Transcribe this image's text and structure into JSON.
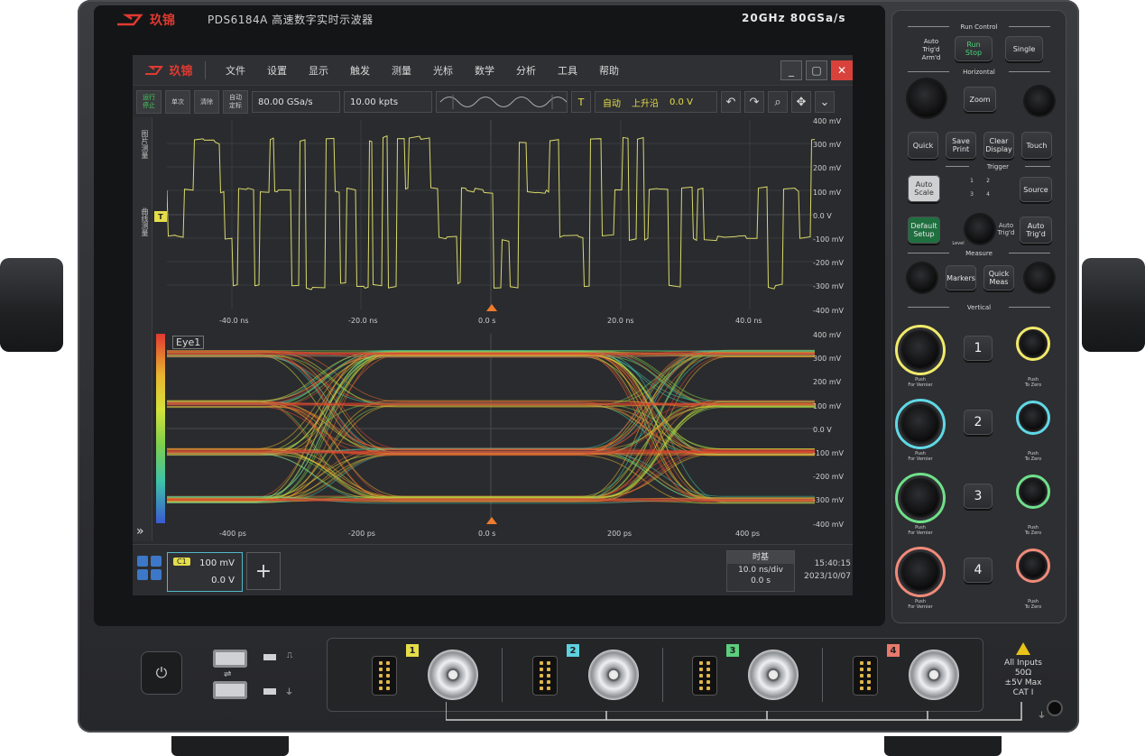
{
  "device": {
    "brand": "玖锦",
    "model_title": "PDS6184A 高速数字实时示波器",
    "spec": "20GHz 80GSa/s"
  },
  "screen": {
    "brand": "玖锦",
    "menu": [
      "文件",
      "设置",
      "显示",
      "触发",
      "测量",
      "光标",
      "数学",
      "分析",
      "工具",
      "帮助"
    ],
    "window_buttons": {
      "minimize": "_",
      "maximize": "▢",
      "close": "✕"
    },
    "toolbar": {
      "run_stop": "运行\n停止",
      "single": "单次",
      "clear": "清除",
      "auto_scale": "自动\n定标",
      "sample_rate": "80.00 GSa/s",
      "memory_depth": "10.00 kpts",
      "trigger_tag": "T",
      "trigger_mode": "自动",
      "trigger_edge": "上升沿",
      "trigger_level": "0.0 V"
    },
    "sidebar_tabs": [
      "图片测量",
      "曲线测量"
    ],
    "waveform": {
      "y_labels": [
        "400 mV",
        "300 mV",
        "200 mV",
        "100 mV",
        "0.0 V",
        "-100 mV",
        "-200 mV",
        "-300 mV",
        "-400 mV"
      ],
      "x_labels": [
        "-40.0 ns",
        "-20.0 ns",
        "0.0 s",
        "20.0 ns",
        "40.0 ns"
      ],
      "trigger_marker": "T"
    },
    "eye": {
      "label": "Eye1",
      "y_labels": [
        "400 mV",
        "300 mV",
        "200 mV",
        "100 mV",
        "0.0 V",
        "-100 mV",
        "-200 mV",
        "-300 mV",
        "-400 mV"
      ],
      "x_labels": [
        "-400 ps",
        "-200 ps",
        "0.0 s",
        "200 ps",
        "400 ps"
      ],
      "expand": "»"
    },
    "bottom": {
      "channel_tag": "C1",
      "channel_scale": "100 mV",
      "channel_offset": "0.0 V",
      "add": "+",
      "timebase_title": "时基",
      "timebase_scale": "10.0 ns/div",
      "timebase_delay": "0.0 s",
      "time": "15:40:15",
      "date": "2023/10/07"
    }
  },
  "panel": {
    "run_control": "Run Control",
    "auto_trigd_armd": "Auto\nTrig'd\nArm'd",
    "run_stop": "Run\nStop",
    "single": "Single",
    "horizontal": "Horizontal",
    "zoom": "Zoom",
    "quick": "Quick",
    "save_print": "Save\nPrint",
    "clear_display": "Clear\nDisplay",
    "touch": "Touch",
    "trigger": "Trigger",
    "trigger_nums": [
      "1",
      "2",
      "3",
      "4"
    ],
    "auto_scale": "Auto\nScale",
    "source": "Source",
    "default_setup": "Default\nSetup",
    "level": "Level",
    "auto_trigd": "Auto\nTrig'd",
    "auto_trigd_btn": "Auto\nTrig'd",
    "measure": "Measure",
    "markers": "Markers",
    "quick_meas": "Quick\nMeas",
    "vertical": "Vertical",
    "channels": [
      "1",
      "2",
      "3",
      "4"
    ],
    "push_fine": "Push\nFor Vernier",
    "push_zero": "Push\nTo Zero",
    "ring_colors": [
      "#f1ea6a",
      "#5fd8e6",
      "#6fe08a",
      "#f08a7a"
    ]
  },
  "front": {
    "channels": [
      "1",
      "2",
      "3",
      "4"
    ],
    "channel_colors": [
      "#e5dd4a",
      "#5fd0e0",
      "#5ccf7d",
      "#e87a6c"
    ],
    "all_inputs": "All Inputs",
    "impedance": "50Ω",
    "max_v": "±5V Max",
    "cat": "CAT Ⅰ"
  }
}
